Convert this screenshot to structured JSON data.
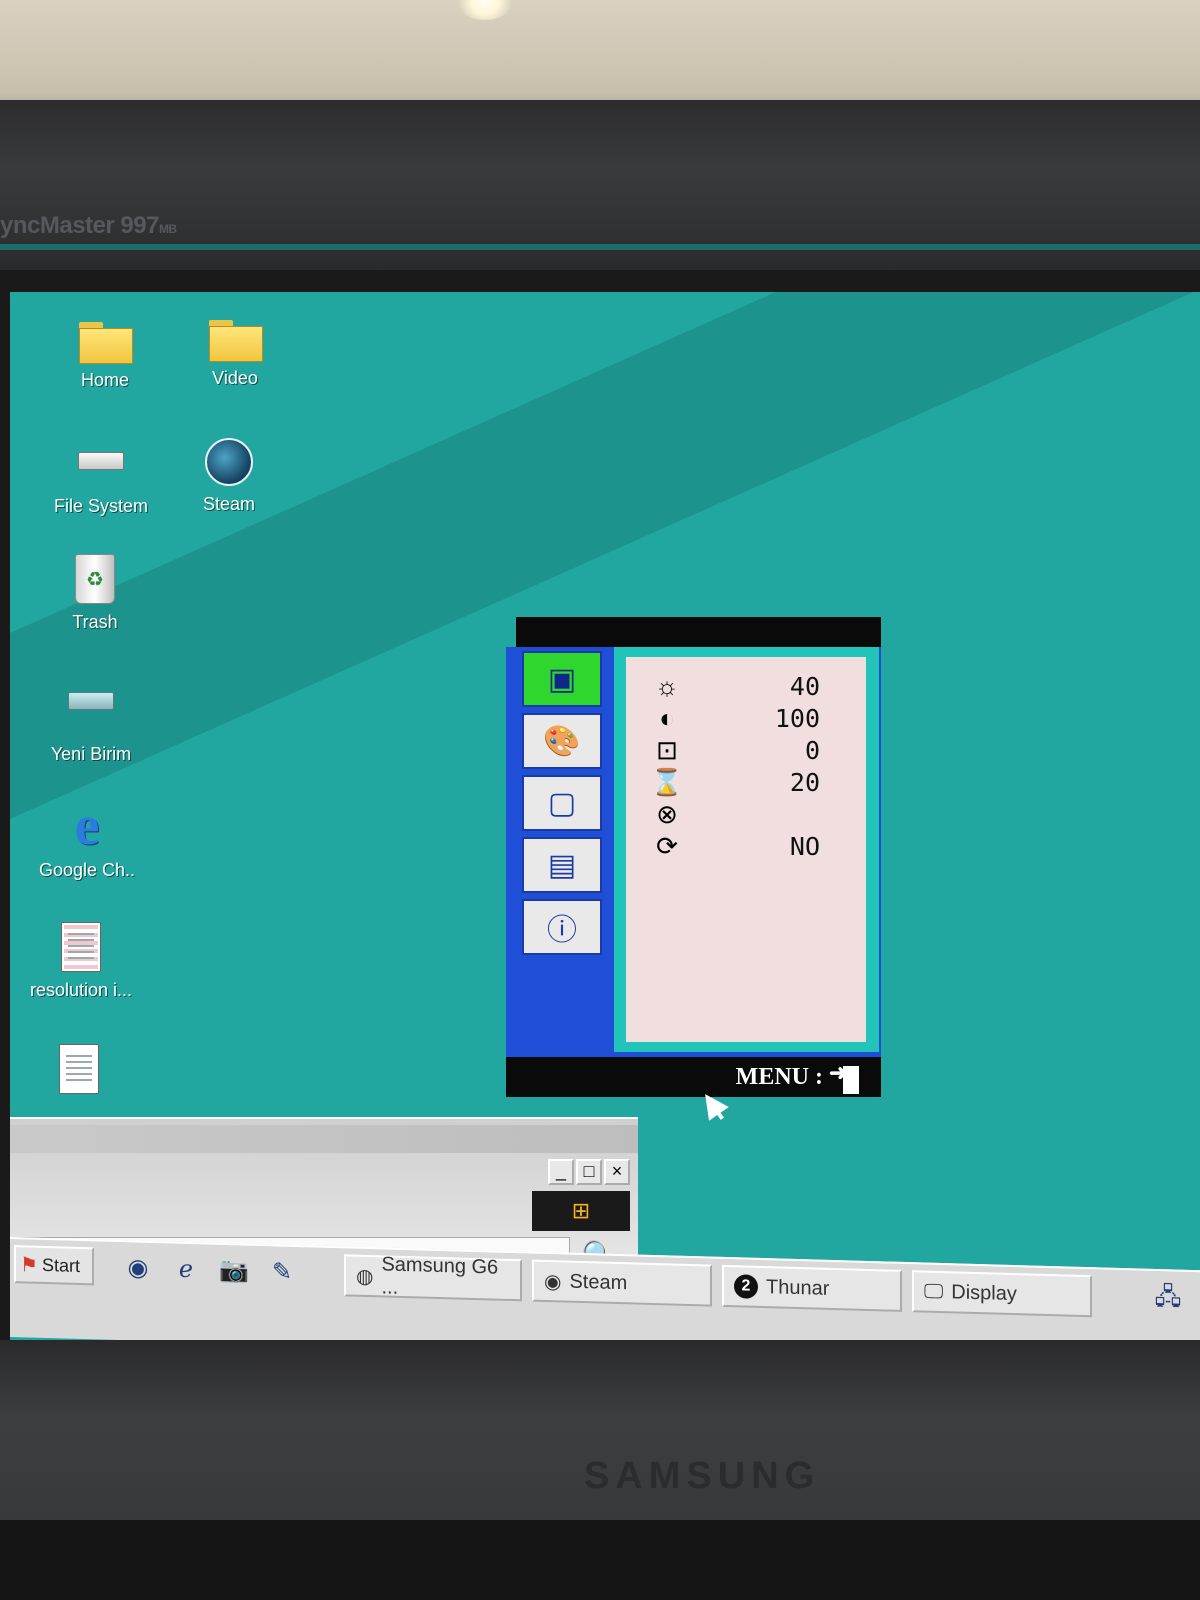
{
  "monitor": {
    "model_label": "yncMaster 997",
    "model_suffix": "MB",
    "brand": "SAMSUNG"
  },
  "desktop": {
    "icons": [
      {
        "label": "Home",
        "icon": "home-folder-icon"
      },
      {
        "label": "Video",
        "icon": "folder-icon"
      },
      {
        "label": "File System",
        "icon": "drive-icon"
      },
      {
        "label": "Steam",
        "icon": "steam-icon"
      },
      {
        "label": "Trash",
        "icon": "trash-icon"
      },
      {
        "label": "Yeni Birim",
        "icon": "removable-drive-icon"
      },
      {
        "label": "Google Ch..",
        "icon": "internet-explorer-icon"
      },
      {
        "label": "resolution i...",
        "icon": "text-document-icon"
      }
    ]
  },
  "osd": {
    "tabs": [
      {
        "name": "picture",
        "glyph": "▣",
        "active": true
      },
      {
        "name": "color",
        "glyph": "🎨",
        "active": false
      },
      {
        "name": "geometry",
        "glyph": "▢",
        "active": false
      },
      {
        "name": "setup",
        "glyph": "▤",
        "active": false
      },
      {
        "name": "information",
        "glyph": "ⓘ",
        "active": false
      }
    ],
    "rows": [
      {
        "icon": "☼",
        "value": "40"
      },
      {
        "icon": "◐",
        "value": "100"
      },
      {
        "icon": "⊡",
        "value": "0"
      },
      {
        "icon": "⌛",
        "value": "20"
      },
      {
        "icon": "⊗",
        "value": ""
      },
      {
        "icon": "⟳",
        "value": "NO"
      }
    ],
    "menu_label": "MENU :"
  },
  "window": {
    "minimize": "_",
    "maximize": "□",
    "close": "×"
  },
  "taskbar": {
    "start_label": "Start",
    "tasks": [
      {
        "label": "Samsung G6 ...",
        "icon": "chrome-icon"
      },
      {
        "label": "Steam",
        "icon": "steam-icon"
      },
      {
        "label": "Thunar",
        "icon": "thunar-icon",
        "badge": "2"
      },
      {
        "label": "Display",
        "icon": "display-icon"
      }
    ]
  }
}
